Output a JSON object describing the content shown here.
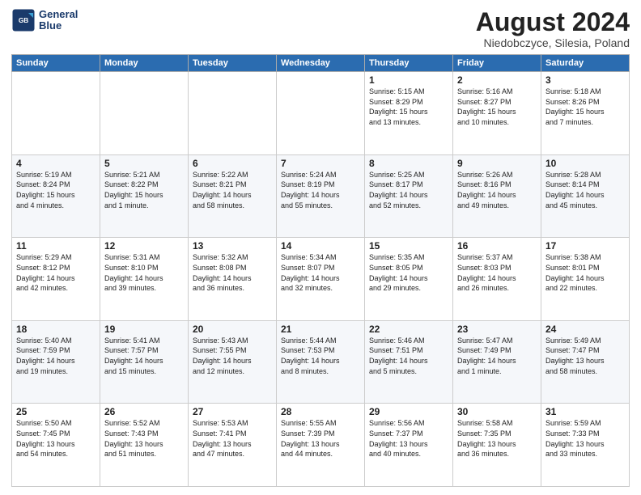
{
  "logo": {
    "line1": "General",
    "line2": "Blue"
  },
  "title": "August 2024",
  "subtitle": "Niedobczyce, Silesia, Poland",
  "days_of_week": [
    "Sunday",
    "Monday",
    "Tuesday",
    "Wednesday",
    "Thursday",
    "Friday",
    "Saturday"
  ],
  "weeks": [
    [
      {
        "day": "",
        "info": ""
      },
      {
        "day": "",
        "info": ""
      },
      {
        "day": "",
        "info": ""
      },
      {
        "day": "",
        "info": ""
      },
      {
        "day": "1",
        "info": "Sunrise: 5:15 AM\nSunset: 8:29 PM\nDaylight: 15 hours\nand 13 minutes."
      },
      {
        "day": "2",
        "info": "Sunrise: 5:16 AM\nSunset: 8:27 PM\nDaylight: 15 hours\nand 10 minutes."
      },
      {
        "day": "3",
        "info": "Sunrise: 5:18 AM\nSunset: 8:26 PM\nDaylight: 15 hours\nand 7 minutes."
      }
    ],
    [
      {
        "day": "4",
        "info": "Sunrise: 5:19 AM\nSunset: 8:24 PM\nDaylight: 15 hours\nand 4 minutes."
      },
      {
        "day": "5",
        "info": "Sunrise: 5:21 AM\nSunset: 8:22 PM\nDaylight: 15 hours\nand 1 minute."
      },
      {
        "day": "6",
        "info": "Sunrise: 5:22 AM\nSunset: 8:21 PM\nDaylight: 14 hours\nand 58 minutes."
      },
      {
        "day": "7",
        "info": "Sunrise: 5:24 AM\nSunset: 8:19 PM\nDaylight: 14 hours\nand 55 minutes."
      },
      {
        "day": "8",
        "info": "Sunrise: 5:25 AM\nSunset: 8:17 PM\nDaylight: 14 hours\nand 52 minutes."
      },
      {
        "day": "9",
        "info": "Sunrise: 5:26 AM\nSunset: 8:16 PM\nDaylight: 14 hours\nand 49 minutes."
      },
      {
        "day": "10",
        "info": "Sunrise: 5:28 AM\nSunset: 8:14 PM\nDaylight: 14 hours\nand 45 minutes."
      }
    ],
    [
      {
        "day": "11",
        "info": "Sunrise: 5:29 AM\nSunset: 8:12 PM\nDaylight: 14 hours\nand 42 minutes."
      },
      {
        "day": "12",
        "info": "Sunrise: 5:31 AM\nSunset: 8:10 PM\nDaylight: 14 hours\nand 39 minutes."
      },
      {
        "day": "13",
        "info": "Sunrise: 5:32 AM\nSunset: 8:08 PM\nDaylight: 14 hours\nand 36 minutes."
      },
      {
        "day": "14",
        "info": "Sunrise: 5:34 AM\nSunset: 8:07 PM\nDaylight: 14 hours\nand 32 minutes."
      },
      {
        "day": "15",
        "info": "Sunrise: 5:35 AM\nSunset: 8:05 PM\nDaylight: 14 hours\nand 29 minutes."
      },
      {
        "day": "16",
        "info": "Sunrise: 5:37 AM\nSunset: 8:03 PM\nDaylight: 14 hours\nand 26 minutes."
      },
      {
        "day": "17",
        "info": "Sunrise: 5:38 AM\nSunset: 8:01 PM\nDaylight: 14 hours\nand 22 minutes."
      }
    ],
    [
      {
        "day": "18",
        "info": "Sunrise: 5:40 AM\nSunset: 7:59 PM\nDaylight: 14 hours\nand 19 minutes."
      },
      {
        "day": "19",
        "info": "Sunrise: 5:41 AM\nSunset: 7:57 PM\nDaylight: 14 hours\nand 15 minutes."
      },
      {
        "day": "20",
        "info": "Sunrise: 5:43 AM\nSunset: 7:55 PM\nDaylight: 14 hours\nand 12 minutes."
      },
      {
        "day": "21",
        "info": "Sunrise: 5:44 AM\nSunset: 7:53 PM\nDaylight: 14 hours\nand 8 minutes."
      },
      {
        "day": "22",
        "info": "Sunrise: 5:46 AM\nSunset: 7:51 PM\nDaylight: 14 hours\nand 5 minutes."
      },
      {
        "day": "23",
        "info": "Sunrise: 5:47 AM\nSunset: 7:49 PM\nDaylight: 14 hours\nand 1 minute."
      },
      {
        "day": "24",
        "info": "Sunrise: 5:49 AM\nSunset: 7:47 PM\nDaylight: 13 hours\nand 58 minutes."
      }
    ],
    [
      {
        "day": "25",
        "info": "Sunrise: 5:50 AM\nSunset: 7:45 PM\nDaylight: 13 hours\nand 54 minutes."
      },
      {
        "day": "26",
        "info": "Sunrise: 5:52 AM\nSunset: 7:43 PM\nDaylight: 13 hours\nand 51 minutes."
      },
      {
        "day": "27",
        "info": "Sunrise: 5:53 AM\nSunset: 7:41 PM\nDaylight: 13 hours\nand 47 minutes."
      },
      {
        "day": "28",
        "info": "Sunrise: 5:55 AM\nSunset: 7:39 PM\nDaylight: 13 hours\nand 44 minutes."
      },
      {
        "day": "29",
        "info": "Sunrise: 5:56 AM\nSunset: 7:37 PM\nDaylight: 13 hours\nand 40 minutes."
      },
      {
        "day": "30",
        "info": "Sunrise: 5:58 AM\nSunset: 7:35 PM\nDaylight: 13 hours\nand 36 minutes."
      },
      {
        "day": "31",
        "info": "Sunrise: 5:59 AM\nSunset: 7:33 PM\nDaylight: 13 hours\nand 33 minutes."
      }
    ]
  ]
}
